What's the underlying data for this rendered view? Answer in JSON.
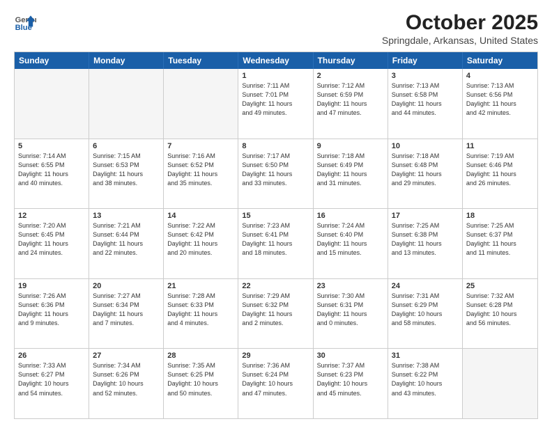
{
  "logo": {
    "line1": "General",
    "line2": "Blue"
  },
  "title": "October 2025",
  "subtitle": "Springdale, Arkansas, United States",
  "weekdays": [
    "Sunday",
    "Monday",
    "Tuesday",
    "Wednesday",
    "Thursday",
    "Friday",
    "Saturday"
  ],
  "rows": [
    [
      {
        "day": "",
        "info": "",
        "empty": true
      },
      {
        "day": "",
        "info": "",
        "empty": true
      },
      {
        "day": "",
        "info": "",
        "empty": true
      },
      {
        "day": "1",
        "info": "Sunrise: 7:11 AM\nSunset: 7:01 PM\nDaylight: 11 hours\nand 49 minutes."
      },
      {
        "day": "2",
        "info": "Sunrise: 7:12 AM\nSunset: 6:59 PM\nDaylight: 11 hours\nand 47 minutes."
      },
      {
        "day": "3",
        "info": "Sunrise: 7:13 AM\nSunset: 6:58 PM\nDaylight: 11 hours\nand 44 minutes."
      },
      {
        "day": "4",
        "info": "Sunrise: 7:13 AM\nSunset: 6:56 PM\nDaylight: 11 hours\nand 42 minutes."
      }
    ],
    [
      {
        "day": "5",
        "info": "Sunrise: 7:14 AM\nSunset: 6:55 PM\nDaylight: 11 hours\nand 40 minutes."
      },
      {
        "day": "6",
        "info": "Sunrise: 7:15 AM\nSunset: 6:53 PM\nDaylight: 11 hours\nand 38 minutes."
      },
      {
        "day": "7",
        "info": "Sunrise: 7:16 AM\nSunset: 6:52 PM\nDaylight: 11 hours\nand 35 minutes."
      },
      {
        "day": "8",
        "info": "Sunrise: 7:17 AM\nSunset: 6:50 PM\nDaylight: 11 hours\nand 33 minutes."
      },
      {
        "day": "9",
        "info": "Sunrise: 7:18 AM\nSunset: 6:49 PM\nDaylight: 11 hours\nand 31 minutes."
      },
      {
        "day": "10",
        "info": "Sunrise: 7:18 AM\nSunset: 6:48 PM\nDaylight: 11 hours\nand 29 minutes."
      },
      {
        "day": "11",
        "info": "Sunrise: 7:19 AM\nSunset: 6:46 PM\nDaylight: 11 hours\nand 26 minutes."
      }
    ],
    [
      {
        "day": "12",
        "info": "Sunrise: 7:20 AM\nSunset: 6:45 PM\nDaylight: 11 hours\nand 24 minutes."
      },
      {
        "day": "13",
        "info": "Sunrise: 7:21 AM\nSunset: 6:44 PM\nDaylight: 11 hours\nand 22 minutes."
      },
      {
        "day": "14",
        "info": "Sunrise: 7:22 AM\nSunset: 6:42 PM\nDaylight: 11 hours\nand 20 minutes."
      },
      {
        "day": "15",
        "info": "Sunrise: 7:23 AM\nSunset: 6:41 PM\nDaylight: 11 hours\nand 18 minutes."
      },
      {
        "day": "16",
        "info": "Sunrise: 7:24 AM\nSunset: 6:40 PM\nDaylight: 11 hours\nand 15 minutes."
      },
      {
        "day": "17",
        "info": "Sunrise: 7:25 AM\nSunset: 6:38 PM\nDaylight: 11 hours\nand 13 minutes."
      },
      {
        "day": "18",
        "info": "Sunrise: 7:25 AM\nSunset: 6:37 PM\nDaylight: 11 hours\nand 11 minutes."
      }
    ],
    [
      {
        "day": "19",
        "info": "Sunrise: 7:26 AM\nSunset: 6:36 PM\nDaylight: 11 hours\nand 9 minutes."
      },
      {
        "day": "20",
        "info": "Sunrise: 7:27 AM\nSunset: 6:34 PM\nDaylight: 11 hours\nand 7 minutes."
      },
      {
        "day": "21",
        "info": "Sunrise: 7:28 AM\nSunset: 6:33 PM\nDaylight: 11 hours\nand 4 minutes."
      },
      {
        "day": "22",
        "info": "Sunrise: 7:29 AM\nSunset: 6:32 PM\nDaylight: 11 hours\nand 2 minutes."
      },
      {
        "day": "23",
        "info": "Sunrise: 7:30 AM\nSunset: 6:31 PM\nDaylight: 11 hours\nand 0 minutes."
      },
      {
        "day": "24",
        "info": "Sunrise: 7:31 AM\nSunset: 6:29 PM\nDaylight: 10 hours\nand 58 minutes."
      },
      {
        "day": "25",
        "info": "Sunrise: 7:32 AM\nSunset: 6:28 PM\nDaylight: 10 hours\nand 56 minutes."
      }
    ],
    [
      {
        "day": "26",
        "info": "Sunrise: 7:33 AM\nSunset: 6:27 PM\nDaylight: 10 hours\nand 54 minutes."
      },
      {
        "day": "27",
        "info": "Sunrise: 7:34 AM\nSunset: 6:26 PM\nDaylight: 10 hours\nand 52 minutes."
      },
      {
        "day": "28",
        "info": "Sunrise: 7:35 AM\nSunset: 6:25 PM\nDaylight: 10 hours\nand 50 minutes."
      },
      {
        "day": "29",
        "info": "Sunrise: 7:36 AM\nSunset: 6:24 PM\nDaylight: 10 hours\nand 47 minutes."
      },
      {
        "day": "30",
        "info": "Sunrise: 7:37 AM\nSunset: 6:23 PM\nDaylight: 10 hours\nand 45 minutes."
      },
      {
        "day": "31",
        "info": "Sunrise: 7:38 AM\nSunset: 6:22 PM\nDaylight: 10 hours\nand 43 minutes."
      },
      {
        "day": "",
        "info": "",
        "empty": true
      }
    ]
  ]
}
